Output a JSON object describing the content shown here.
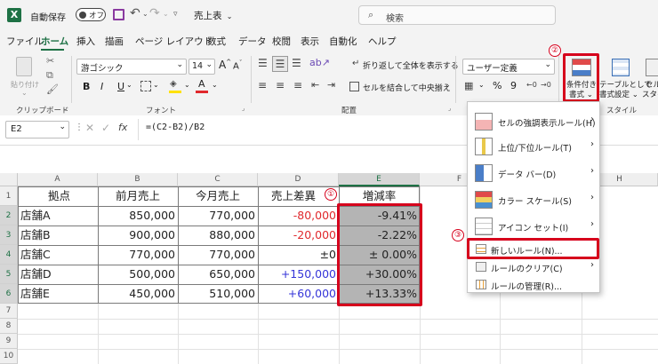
{
  "titlebar": {
    "autosave_label": "自動保存",
    "autosave_state": "オフ",
    "file_name": "売上表",
    "search_placeholder": "検索"
  },
  "menu": [
    "ファイル",
    "ホーム",
    "挿入",
    "描画",
    "ページ レイアウト",
    "数式",
    "データ",
    "校閲",
    "表示",
    "自動化",
    "ヘルプ"
  ],
  "ribbon": {
    "paste_label": "貼り付け",
    "font_name": "游ゴシック",
    "font_size": "14",
    "wrap_text": "折り返して全体を表示する",
    "merge_center": "セルを結合して中央揃え",
    "number_format": "ユーザー定義",
    "percent": "%",
    "comma": "9",
    "conditional_format_line1": "条件付き",
    "conditional_format_line2": "書式",
    "format_table_line1": "テーブルとして",
    "format_table_line2": "書式設定",
    "cell_styles_line1": "セル",
    "cell_styles_line2": "スタイル",
    "group_clipboard": "クリップボード",
    "group_font": "フォント",
    "group_alignment": "配置",
    "group_style": "スタイル",
    "bold": "B",
    "italic": "I",
    "underline": "U",
    "font_color_letter": "A",
    "grow_font": "A^",
    "shrink_font": "Aˇ"
  },
  "formula_bar": {
    "name_box": "E2",
    "fx": "fx",
    "formula": "=(C2-B2)/B2"
  },
  "columns": [
    "A",
    "B",
    "C",
    "D",
    "E",
    "F",
    "H"
  ],
  "rows": [
    "1",
    "2",
    "3",
    "4",
    "5",
    "6",
    "7",
    "8",
    "9",
    "10"
  ],
  "table": {
    "headers": [
      "拠点",
      "前月売上",
      "今月売上",
      "売上差異",
      "増減率"
    ],
    "rows": [
      [
        "店舗A",
        "850,000",
        "770,000",
        "-80,000",
        "-9.41%"
      ],
      [
        "店舗B",
        "900,000",
        "880,000",
        "-20,000",
        "-2.22%"
      ],
      [
        "店舗C",
        "770,000",
        "770,000",
        "±0",
        "± 0.00%"
      ],
      [
        "店舗D",
        "500,000",
        "650,000",
        "+150,000",
        "+30.00%"
      ],
      [
        "店舗E",
        "450,000",
        "510,000",
        "+60,000",
        "+13.33%"
      ]
    ]
  },
  "dropdown": {
    "items": [
      "セルの強調表示ルール(H)",
      "上位/下位ルール(T)",
      "データ バー(D)",
      "カラー スケール(S)",
      "アイコン セット(I)",
      "新しいルール(N)...",
      "ルールのクリア(C)",
      "ルールの管理(R)..."
    ]
  },
  "callouts": [
    "①",
    "②",
    "③"
  ],
  "colors": {
    "accent_red": "#d6001c",
    "negative": "#e0282c",
    "positive": "#3535d8",
    "selected_fill": "#b4b4b4",
    "excel_green": "#1e7145"
  }
}
